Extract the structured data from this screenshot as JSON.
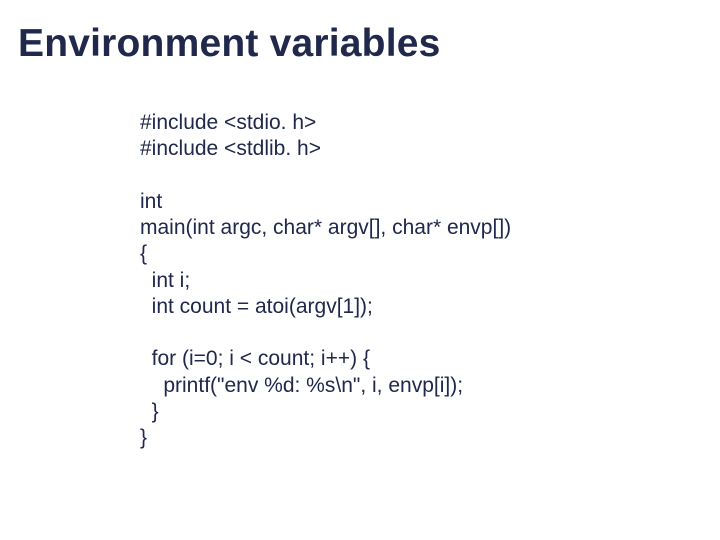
{
  "slide": {
    "title": "Environment variables",
    "code": "#include <stdio. h>\n#include <stdlib. h>\n\nint\nmain(int argc, char* argv[], char* envp[])\n{\n  int i;\n  int count = atoi(argv[1]);\n\n  for (i=0; i < count; i++) {\n    printf(\"env %d: %s\\n\", i, envp[i]);\n  }\n}"
  }
}
